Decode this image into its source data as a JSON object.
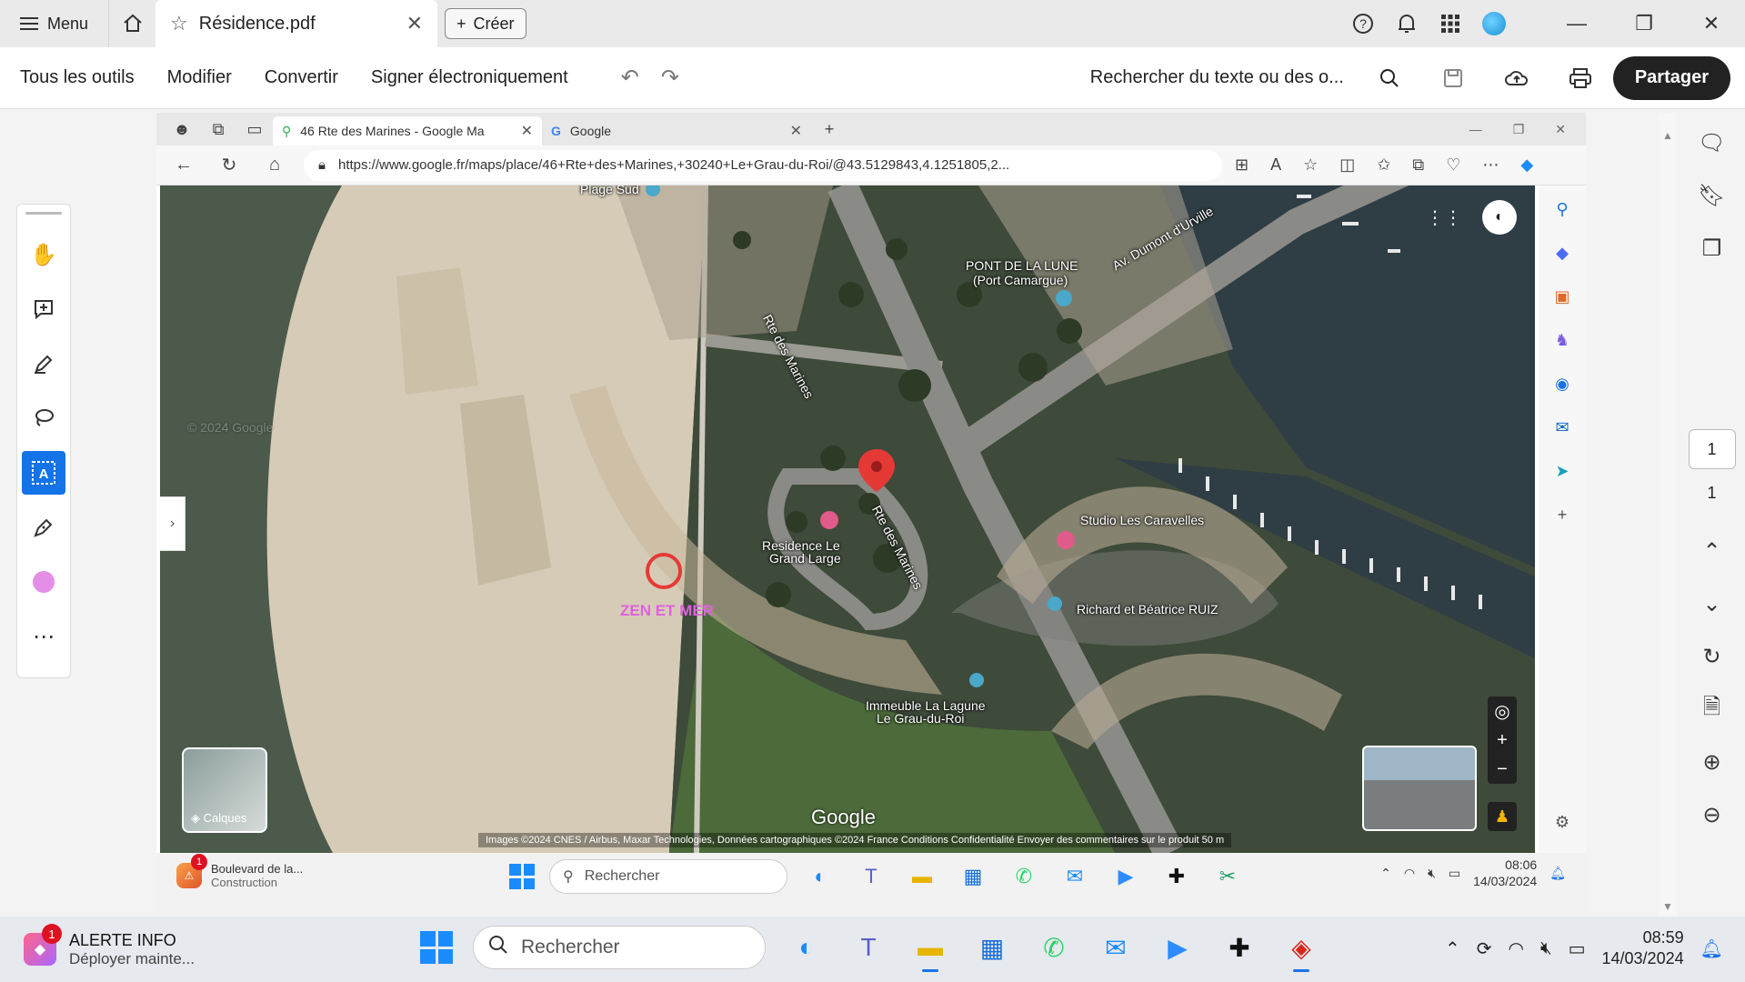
{
  "acrobat": {
    "menu_label": "Menu",
    "tab_title": "Résidence.pdf",
    "create_label": "Créer",
    "tools": [
      "Tous les outils",
      "Modifier",
      "Convertir",
      "Signer électroniquement"
    ],
    "search_label": "Rechercher du texte ou des o...",
    "share_label": "Partager",
    "page_current": "1",
    "page_total": "1"
  },
  "edge": {
    "tabs": [
      {
        "title": "46 Rte des Marines - Google Ma"
      },
      {
        "title": "Google"
      }
    ],
    "url": "https://www.google.fr/maps/place/46+Rte+des+Marines,+30240+Le+Grau-du-Roi/@43.5129843,4.1251805,2..."
  },
  "map": {
    "labels": {
      "plage_sud": "Plage Sud",
      "pont_line1": "PONT DE LA LUNE",
      "pont_line2": "(Port Camargue)",
      "av_dumont": "Av. Dumont d'Urville",
      "rte_marines_1": "Rte des Marines",
      "rte_marines_2": "Rte des Marines",
      "residence_line1": "Residence Le",
      "residence_line2": "Grand Large",
      "studio": "Studio Les Caravelles",
      "ruiz": "Richard et Béatrice RUIZ",
      "immeuble_line1": "Immeuble La Lagune",
      "immeuble_line2": "Le Grau-du-Roi",
      "zen": "ZEN ET MER",
      "watermark": "© 2024 Google",
      "google": "Google",
      "attribution": "Images ©2024 CNES / Airbus, Maxar Technologies, Données cartographiques ©2024    France    Conditions    Confidentialité    Envoyer des commentaires sur le produit    50 m",
      "layers": "Calques"
    }
  },
  "inner_taskbar": {
    "news_title": "Boulevard de la...",
    "news_sub": "Construction",
    "news_badge": "1",
    "search": "Rechercher",
    "time": "08:06",
    "date": "14/03/2024"
  },
  "taskbar": {
    "alert_title": "ALERTE INFO",
    "alert_sub": "Déployer mainte...",
    "alert_badge": "1",
    "search": "Rechercher",
    "time": "08:59",
    "date": "14/03/2024"
  }
}
